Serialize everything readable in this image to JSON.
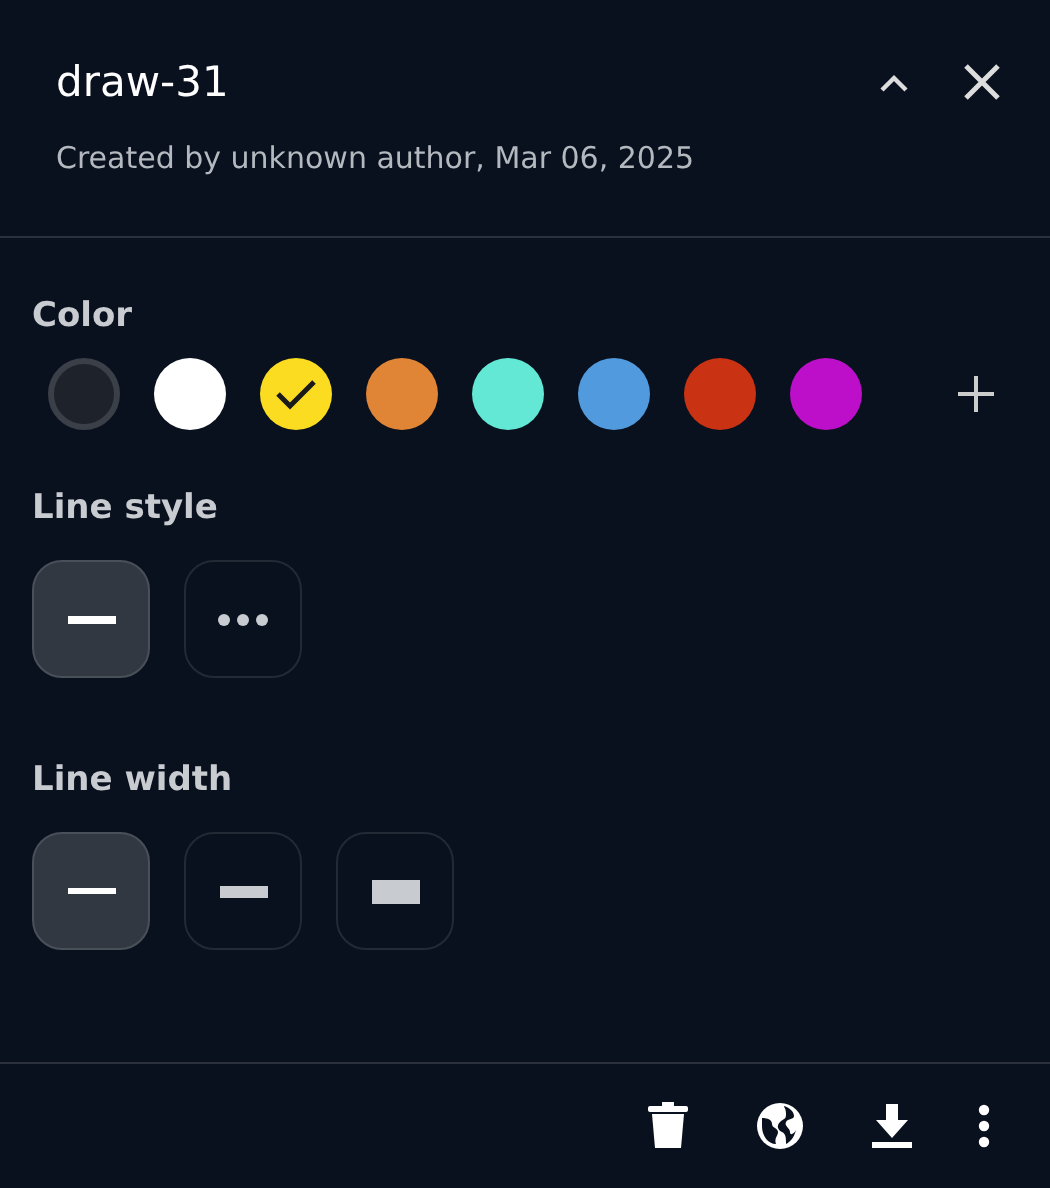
{
  "header": {
    "title": "draw-31",
    "subtitle": "Created by unknown author, Mar 06, 2025"
  },
  "color": {
    "label": "Color",
    "swatches": [
      {
        "color": "#1e232b",
        "selected": false
      },
      {
        "color": "#ffffff",
        "selected": false
      },
      {
        "color": "#fbdc21",
        "selected": true
      },
      {
        "color": "#e08435",
        "selected": false
      },
      {
        "color": "#62e8d4",
        "selected": false
      },
      {
        "color": "#519ade",
        "selected": false
      },
      {
        "color": "#c93213",
        "selected": false
      },
      {
        "color": "#bd0fc9",
        "selected": false
      }
    ]
  },
  "line_style": {
    "label": "Line style",
    "options": [
      {
        "kind": "solid",
        "selected": true
      },
      {
        "kind": "dotted",
        "selected": false
      }
    ]
  },
  "line_width": {
    "label": "Line width",
    "options": [
      {
        "kind": "thin",
        "selected": true
      },
      {
        "kind": "medium",
        "selected": false
      },
      {
        "kind": "thick",
        "selected": false
      }
    ]
  }
}
